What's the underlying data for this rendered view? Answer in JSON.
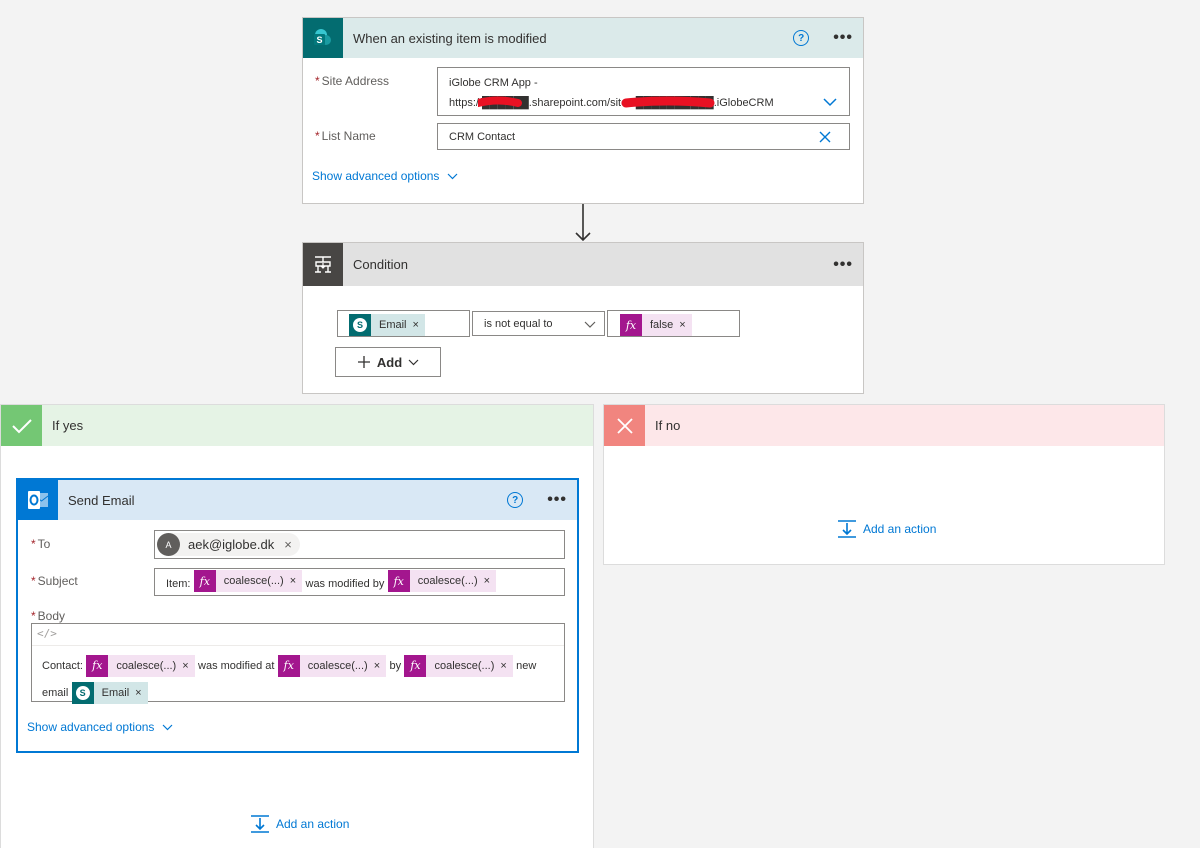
{
  "trigger": {
    "title": "When an existing item is modified",
    "help": "?",
    "more": "•••",
    "site_address_label": "Site Address",
    "site_address_line1": "iGlobe CRM App -",
    "site_address_line2": "https://██████.sharepoint.com/sites/██████████.iGlobeCRM",
    "list_name_label": "List Name",
    "list_name_value": "CRM Contact",
    "advanced": "Show advanced options",
    "required": "*"
  },
  "condition": {
    "title": "Condition",
    "more": "•••",
    "left_token": "Email",
    "operator": "is not equal to",
    "right_token": "false",
    "add_label": "Add",
    "token_x": "×"
  },
  "if_yes": {
    "title": "If yes",
    "add_action": "Add an action"
  },
  "if_no": {
    "title": "If no",
    "add_action": "Add an action"
  },
  "send_email": {
    "title": "Send Email",
    "help": "?",
    "more": "•••",
    "required": "*",
    "to_label": "To",
    "to_avatar": "A",
    "to_value": "aek@iglobe.dk",
    "subject_label": "Subject",
    "subject_text1": "Item:",
    "subject_token1": "coalesce(...)",
    "subject_text2": "was modified by",
    "subject_token2": "coalesce(...)",
    "body_label": "Body",
    "code_icon": "</>",
    "body_text1": "Contact:",
    "body_token1": "coalesce(...)",
    "body_text2": "was modified at",
    "body_token2": "coalesce(...)",
    "body_text3": "by",
    "body_token3": "coalesce(...)",
    "body_text4": "new",
    "body_text5": "email",
    "body_token4": "Email",
    "advanced": "Show advanced options",
    "x": "×"
  },
  "icons": {
    "sharepoint": "sharepoint-icon",
    "condition": "condition-icon",
    "check": "check-icon",
    "cross": "close-icon",
    "outlook": "outlook-icon",
    "fx": "fx"
  },
  "colors": {
    "sharepoint": "#036c70",
    "trigger_header": "#dbeaea",
    "condition_header": "#e1e1e1",
    "condition_icon_bg": "#484644",
    "yes_header": "#e5f3e5",
    "yes_icon": "#74c774",
    "no_header": "#fde7e9",
    "no_icon": "#f1857f",
    "outlook": "#0078d4",
    "email_header": "#d9e8f5",
    "accent": "#0078d4",
    "fx_token": "#a3168e"
  }
}
